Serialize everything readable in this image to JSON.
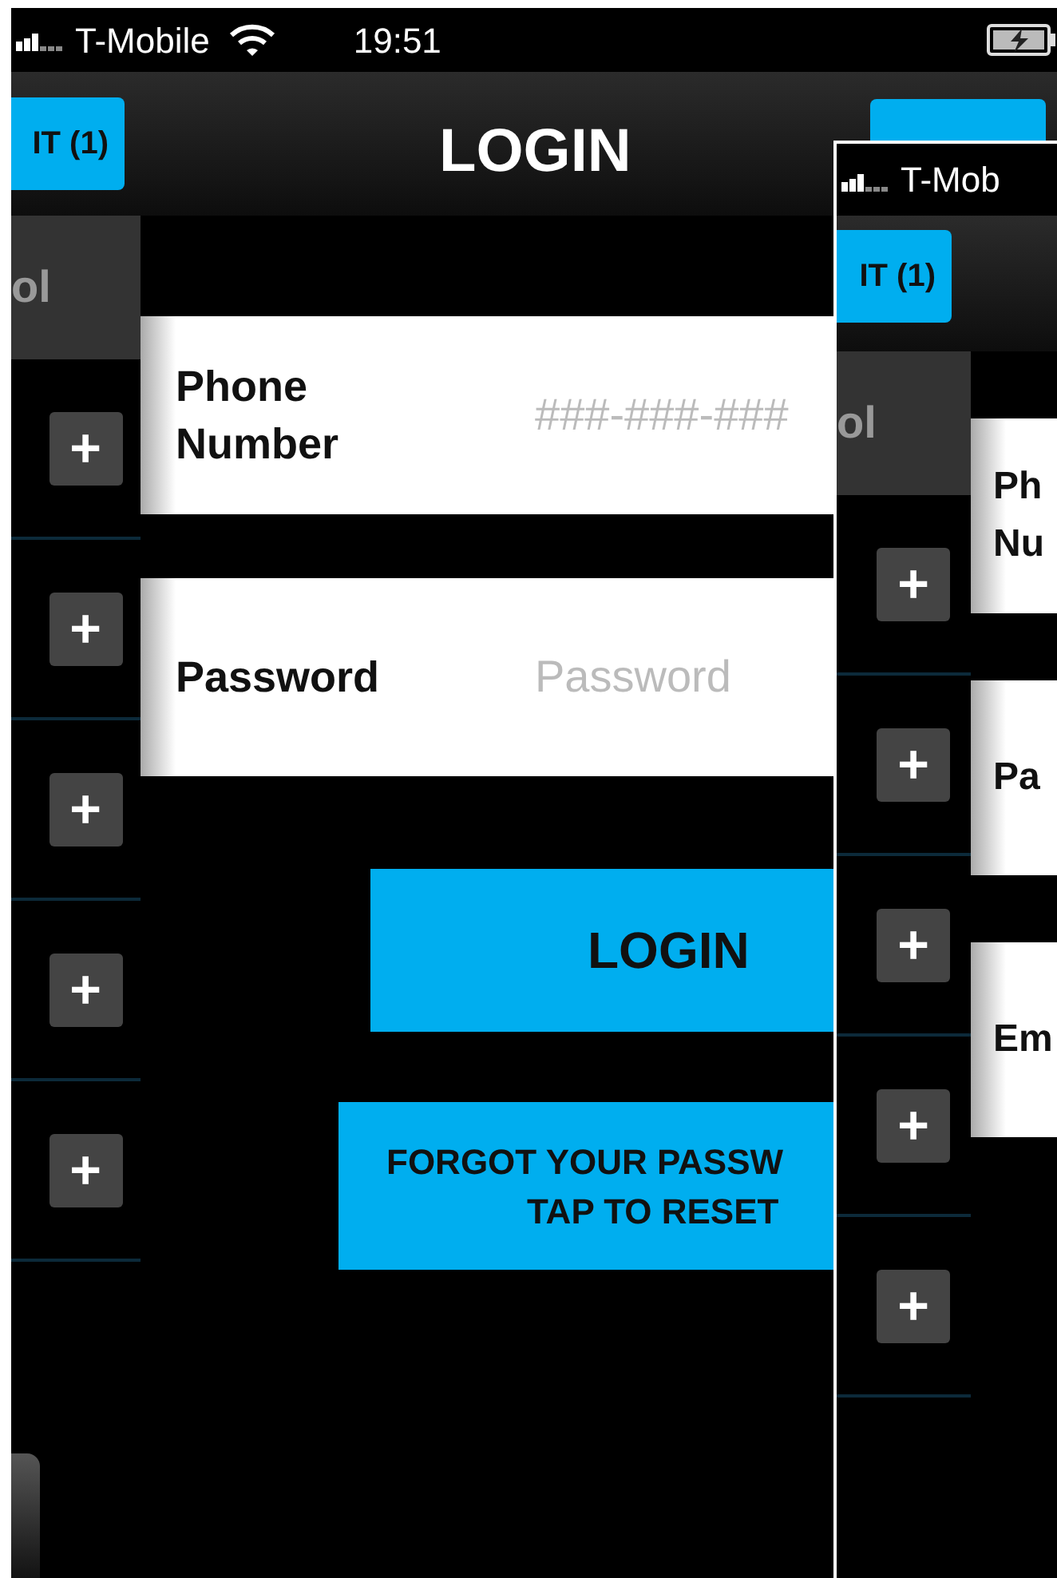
{
  "screens": [
    {
      "status_bar": {
        "carrier": "T-Mobile",
        "wifi": true,
        "time": "19:51",
        "battery": true
      },
      "nav_bar": {
        "left_button": "IT (1)",
        "title": "LOGIN",
        "right_button": true
      },
      "side_panel": {
        "header": "ol",
        "items": [
          {
            "icon": "+"
          },
          {
            "icon": "+"
          },
          {
            "icon": "+"
          },
          {
            "icon": "+"
          },
          {
            "icon": "+"
          }
        ]
      },
      "form": {
        "fields": [
          {
            "label": "Phone Number",
            "placeholder": "###-###-###"
          },
          {
            "label": "Password",
            "placeholder": "Password"
          }
        ],
        "login_button": "LOGIN",
        "reset_button": {
          "lines": [
            "FORGOT YOUR PASSW",
            "TAP TO RESET"
          ]
        }
      }
    },
    {
      "status_bar": {
        "carrier": "T-Mob"
      },
      "nav_bar": {
        "left_button": "IT (1)"
      },
      "side_panel": {
        "header": "ol",
        "items": [
          {
            "icon": "+"
          },
          {
            "icon": "+"
          },
          {
            "icon": "+"
          },
          {
            "icon": "+"
          },
          {
            "icon": "+"
          }
        ]
      },
      "form": {
        "fields": [
          {
            "label_lines": [
              "Ph",
              "Nu"
            ]
          },
          {
            "label_lines": [
              "Pa"
            ]
          },
          {
            "label_lines": [
              "Em"
            ]
          }
        ]
      }
    }
  ]
}
